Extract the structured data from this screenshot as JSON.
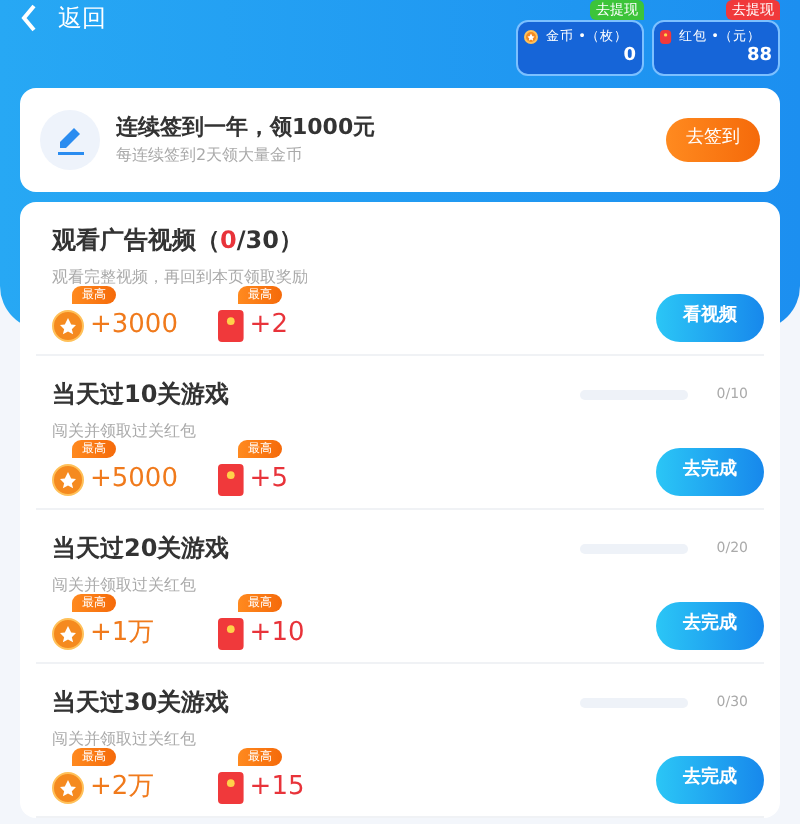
{
  "header": {
    "back_label": "返回",
    "wallets": [
      {
        "kind": "coin",
        "tag": "去提现",
        "color": "#3cc43a",
        "label": "金币 •（枚）",
        "value": "0"
      },
      {
        "kind": "redpacket",
        "tag": "去提现",
        "color": "#f0393b",
        "label": "红包 •（元）",
        "value": "88"
      }
    ]
  },
  "checkin": {
    "title": "连续签到一年，领1000元",
    "subtitle": "每连续签到2天领大量金币",
    "button": "去签到"
  },
  "tasks": [
    {
      "kind": "video",
      "title": "观看广告视频（",
      "count": "0",
      "total": "/30）",
      "subtitle": "观看完整视频，再回到本页领取奖励",
      "rewards": [
        {
          "kind": "coin",
          "badge": "最高",
          "amount": "+3000"
        },
        {
          "kind": "redpacket",
          "badge": "最高",
          "amount": "+2"
        }
      ],
      "button": "看视频"
    },
    {
      "kind": "game",
      "title": "当天过10关游戏",
      "reading": "0/10",
      "subtitle": "闯关并领取过关红包",
      "rewards": [
        {
          "kind": "coin",
          "badge": "最高",
          "amount": "+5000"
        },
        {
          "kind": "redpacket",
          "badge": "最高",
          "amount": "+5"
        }
      ],
      "button": "去完成"
    },
    {
      "kind": "game",
      "title": "当天过20关游戏",
      "reading": "0/20",
      "subtitle": "闯关并领取过关红包",
      "rewards": [
        {
          "kind": "coin",
          "badge": "最高",
          "amount": "+1万"
        },
        {
          "kind": "redpacket",
          "badge": "最高",
          "amount": "+10"
        }
      ],
      "button": "去完成"
    },
    {
      "kind": "game",
      "title": "当天过30关游戏",
      "reading": "0/30",
      "subtitle": "闯关并领取过关红包",
      "rewards": [
        {
          "kind": "coin",
          "badge": "最高",
          "amount": "+2万"
        },
        {
          "kind": "redpacket",
          "badge": "最高",
          "amount": "+15"
        }
      ],
      "button": "去完成"
    }
  ]
}
